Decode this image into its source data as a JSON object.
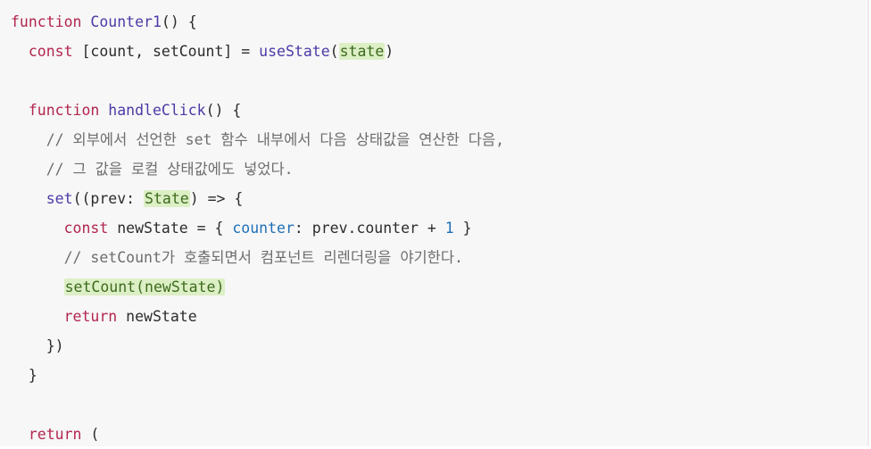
{
  "code": {
    "line1": {
      "kw": "function",
      "name": "Counter1",
      "rest": "() {"
    },
    "line2": {
      "indent": "  ",
      "kw": "const",
      "a": " [count, setCount] = ",
      "fn": "useState",
      "p1": "(",
      "hl": "state",
      "p2": ")"
    },
    "line4": {
      "indent": "  ",
      "kw": "function",
      "name": "handleClick",
      "rest": "() {"
    },
    "line5": {
      "indent": "    ",
      "comment": "// 외부에서 선언한 set 함수 내부에서 다음 상태값을 연산한 다음,"
    },
    "line6": {
      "indent": "    ",
      "comment": "// 그 값을 로컬 상태값에도 넣었다."
    },
    "line7": {
      "indent": "    ",
      "fn": "set",
      "a": "((prev: ",
      "hl": "State",
      "b": ") => {"
    },
    "line8": {
      "indent": "      ",
      "kw": "const",
      "a": " newState = { ",
      "prop": "counter",
      "b": ": prev.counter + ",
      "num": "1",
      "c": " }"
    },
    "line9": {
      "indent": "      ",
      "comment": "// setCount가 호출되면서 컴포넌트 리렌더링을 야기한다."
    },
    "line10": {
      "indent": "      ",
      "hl": "setCount(newState)"
    },
    "line11": {
      "indent": "      ",
      "kw": "return",
      "a": " newState"
    },
    "line12": {
      "indent": "    ",
      "text": "})"
    },
    "line13": {
      "indent": "  ",
      "text": "}"
    },
    "line15": {
      "indent": "  ",
      "kw": "return",
      "a": " ("
    }
  }
}
